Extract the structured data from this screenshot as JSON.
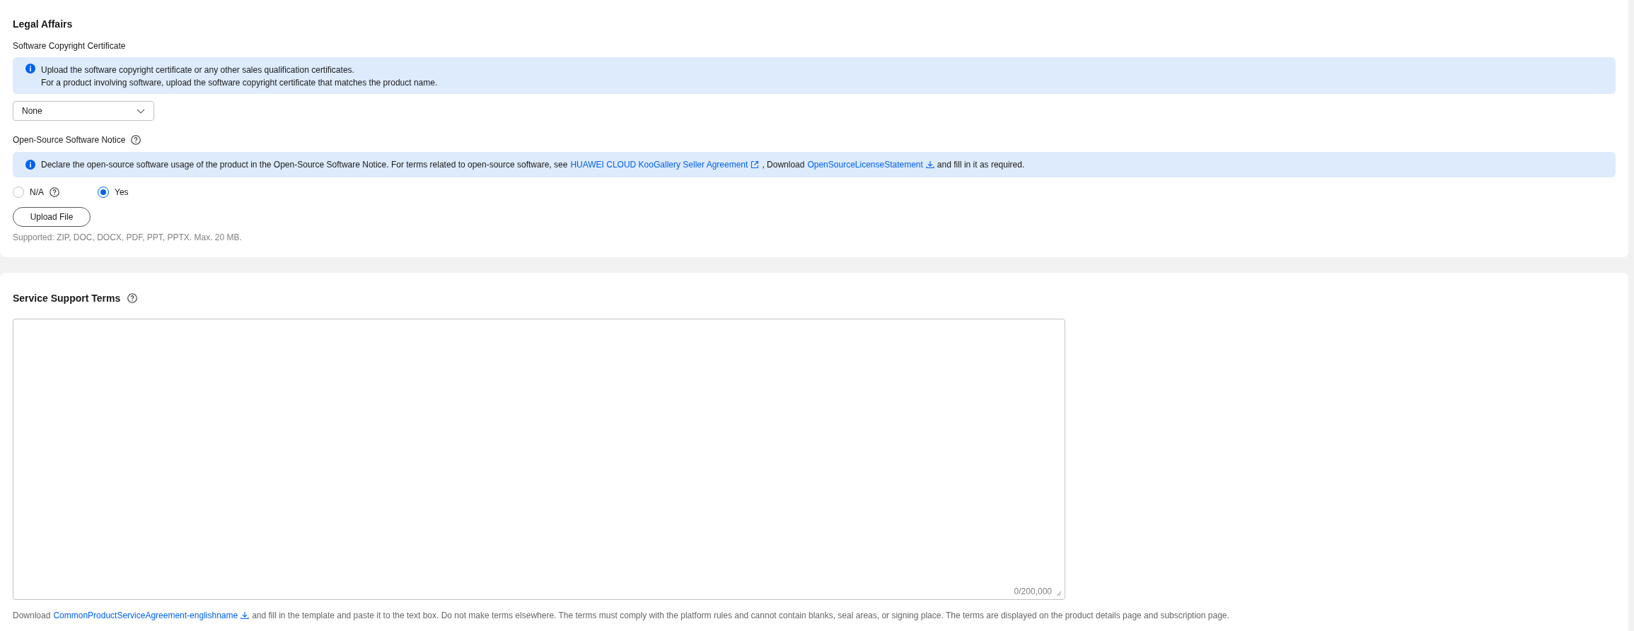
{
  "legal_affairs": {
    "title": "Legal Affairs",
    "copyright": {
      "label": "Software Copyright Certificate",
      "info": [
        "Upload the software copyright certificate or any other sales qualification certificates.",
        "For a product involving software, upload the software copyright certificate that matches the product name."
      ],
      "select_value": "None"
    },
    "open_source": {
      "label": "Open-Source Software Notice",
      "info": [
        {
          "kind": "text",
          "text": "Declare the open-source software usage of the product in the Open-Source Software Notice. For terms related to open-source software, see"
        },
        {
          "kind": "external",
          "text": "HUAWEI CLOUD KooGallery Seller Agreement"
        },
        {
          "kind": "text",
          "text": ", Download"
        },
        {
          "kind": "download",
          "text": "OpenSourceLicenseStatement"
        },
        {
          "kind": "text",
          "text": "and fill in it as required."
        }
      ],
      "options": [
        {
          "label": "N/A",
          "selected": false,
          "help": true
        },
        {
          "label": "Yes",
          "selected": true,
          "help": false
        }
      ],
      "upload_button": "Upload File",
      "supported": "Supported: ZIP, DOC, DOCX, PDF, PPT, PPTX. Max. 20 MB."
    }
  },
  "service_support_terms": {
    "title": "Service Support Terms",
    "counter": "0/200,000",
    "hint": [
      {
        "kind": "text",
        "text": "Download"
      },
      {
        "kind": "download",
        "text": "CommonProductServiceAgreement-englishname"
      },
      {
        "kind": "text",
        "text": "and fill in the template and paste it to the text box. Do not make terms elsewhere. The terms must comply with the platform rules and cannot contain blanks, seal areas, or signing place. The terms are displayed on the product details page and subscription page."
      }
    ]
  }
}
